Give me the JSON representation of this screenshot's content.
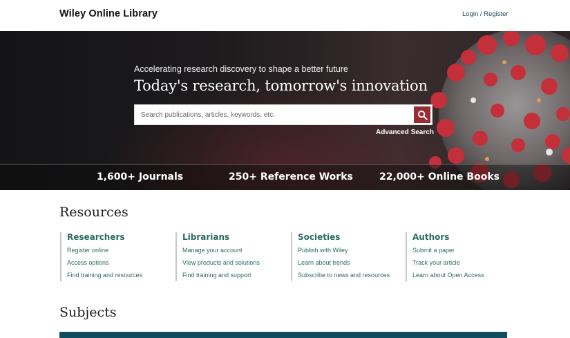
{
  "header": {
    "logo": "Wiley Online Library",
    "login": "Login / Register"
  },
  "hero": {
    "tagline": "Accelerating research discovery to shape a better future",
    "headline": "Today's research, tomorrow's innovation",
    "search_placeholder": "Search publications, articles, keywords, etc.",
    "advanced_search": "Advanced Search",
    "stats": [
      "1,600+ Journals",
      "250+ Reference Works",
      "22,000+ Online Books"
    ]
  },
  "resources": {
    "title": "Resources",
    "columns": [
      {
        "heading": "Researchers",
        "links": [
          "Register online",
          "Access options",
          "Find training and resources"
        ]
      },
      {
        "heading": "Librarians",
        "links": [
          "Manage your account",
          "View products and solutions",
          "Find training and support"
        ]
      },
      {
        "heading": "Societies",
        "links": [
          "Publish with Wiley",
          "Learn about trends",
          "Subscribe to news and resources"
        ]
      },
      {
        "heading": "Authors",
        "links": [
          "Submit a paper",
          "Track your article",
          "Learn about Open Access"
        ]
      }
    ]
  },
  "subjects": {
    "title": "Subjects"
  },
  "colors": {
    "accent": "#2b6b63",
    "search_button": "#9b2b32",
    "subject_bar": "#0f4d5e"
  }
}
